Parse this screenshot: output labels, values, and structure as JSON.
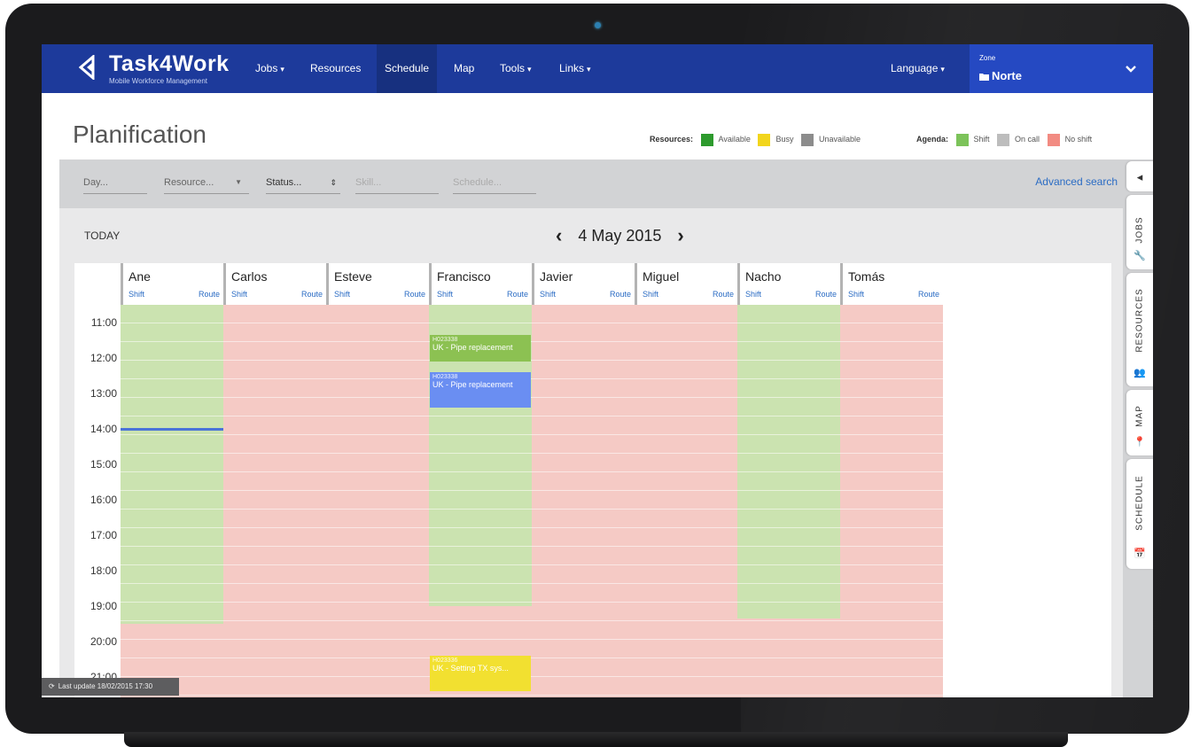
{
  "nav": {
    "brand_name": "Task4Work",
    "brand_sub": "Mobile Workforce Management",
    "items": [
      {
        "label": "Jobs",
        "dropdown": true
      },
      {
        "label": "Resources",
        "dropdown": false
      },
      {
        "label": "Schedule",
        "dropdown": false,
        "active": true
      },
      {
        "label": "Map",
        "dropdown": false
      },
      {
        "label": "Tools",
        "dropdown": true
      },
      {
        "label": "Links",
        "dropdown": true
      }
    ],
    "language": "Language",
    "zone_label": "Zone",
    "zone_value": "Norte",
    "caret": "▾",
    "chevron": "⌄"
  },
  "page": {
    "title": "Planification"
  },
  "legend": {
    "resources_label": "Resources:",
    "available": "Available",
    "busy": "Busy",
    "unavailable": "Unavailable",
    "agenda_label": "Agenda:",
    "shift": "Shift",
    "on_call": "On call",
    "no_shift": "No shift",
    "colors": {
      "available": "#2d9a2d",
      "busy": "#f2d51c",
      "unavailable": "#8c8c8c",
      "shift": "#7cc35a",
      "on_call": "#bdbdbd",
      "no_shift": "#f28b82"
    }
  },
  "filters": {
    "day": "Day...",
    "resource": "Resource...",
    "status": "Status...",
    "skill": "Skill...",
    "schedule": "Schedule...",
    "advanced_search": "Advanced search"
  },
  "calendar": {
    "today_button": "TODAY",
    "date": "4 May 2015",
    "prev": "‹",
    "next": "›",
    "hours": [
      "11:00",
      "12:00",
      "13:00",
      "14:00",
      "15:00",
      "16:00",
      "17:00",
      "18:00",
      "19:00",
      "20:00",
      "21:00"
    ],
    "shift_link": "Shift",
    "route_link": "Route",
    "resources": [
      {
        "name": "Ane",
        "shift": [
          0,
          8.5
        ]
      },
      {
        "name": "Carlos",
        "shift": null
      },
      {
        "name": "Esteve",
        "shift": null
      },
      {
        "name": "Francisco",
        "shift": [
          0,
          8
        ]
      },
      {
        "name": "Javier",
        "shift": null
      },
      {
        "name": "Miguel",
        "shift": null
      },
      {
        "name": "Nacho",
        "shift": [
          0,
          8.35
        ]
      },
      {
        "name": "Tomás",
        "shift": null
      }
    ],
    "events": [
      {
        "resource": 3,
        "id": "H023338",
        "title": "UK - Pipe replacement",
        "start": 0.35,
        "end": 1.1,
        "color": "#8cc152"
      },
      {
        "resource": 3,
        "id": "H023338",
        "title": "UK - Pipe replacement",
        "start": 1.4,
        "end": 2.4,
        "color": "#6a8ef2"
      },
      {
        "resource": 3,
        "id": "H023336",
        "title": "UK - Setting TX sys...",
        "start": 9.4,
        "end": 10.4,
        "color": "#f2e030"
      }
    ],
    "now_hour": 3.0,
    "now_resource": 0
  },
  "sidetabs": {
    "collapse": "◂",
    "jobs": "JOBS",
    "resources": "RESOURCES",
    "map": "MAP",
    "schedule": "SCHEDULE"
  },
  "status": {
    "last_update": "Last update 18/02/2015 17:30"
  }
}
